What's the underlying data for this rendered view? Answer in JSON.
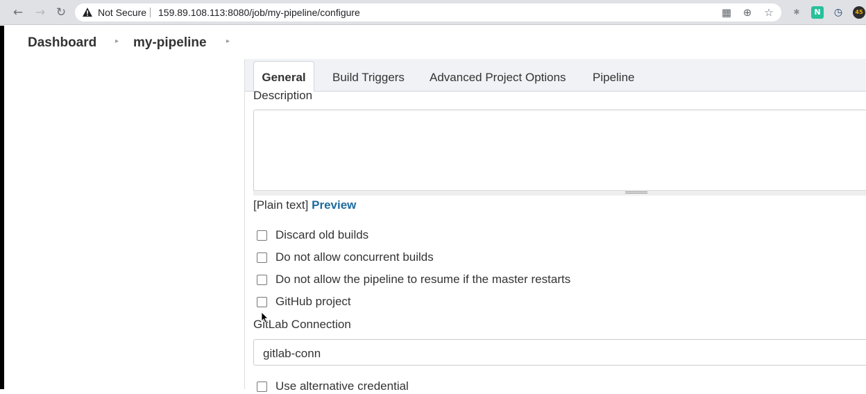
{
  "browser": {
    "security_label": "Not Secure",
    "url": "159.89.108.113:8080/job/my-pipeline/configure",
    "extension_badge": "45"
  },
  "breadcrumb": {
    "items": [
      "Dashboard",
      "my-pipeline"
    ]
  },
  "tabs": [
    {
      "label": "General",
      "active": true
    },
    {
      "label": "Build Triggers",
      "active": false
    },
    {
      "label": "Advanced Project Options",
      "active": false
    },
    {
      "label": "Pipeline",
      "active": false
    }
  ],
  "general": {
    "description_label": "Description",
    "description_value": "",
    "plain_text": "[Plain text]",
    "preview_link": "Preview",
    "checkboxes": [
      {
        "label": "Discard old builds",
        "checked": false
      },
      {
        "label": "Do not allow concurrent builds",
        "checked": false
      },
      {
        "label": "Do not allow the pipeline to resume if the master restarts",
        "checked": false
      },
      {
        "label": "GitHub project",
        "checked": false
      }
    ],
    "gitlab_label": "GitLab Connection",
    "gitlab_value": "gitlab-conn",
    "alt_credential_label": "Use alternative credential"
  },
  "colors": {
    "link": "#1e6a9f",
    "tabbar_bg": "#f0f2f5",
    "chrome_bg": "#dfe1e5"
  }
}
